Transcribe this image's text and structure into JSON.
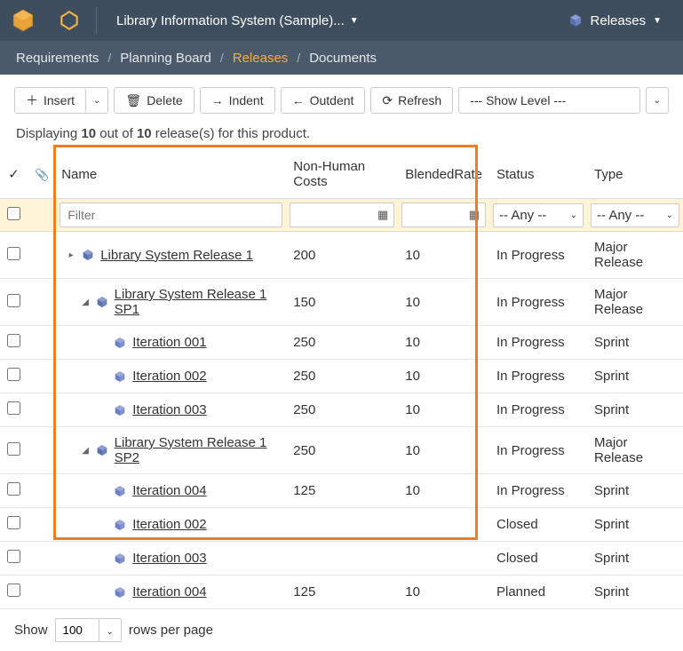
{
  "topbar": {
    "product_label": "Library Information System (Sample)...",
    "releases_label": "Releases"
  },
  "breadcrumb": {
    "items": [
      "Requirements",
      "Planning Board",
      "Releases",
      "Documents"
    ],
    "active_index": 2
  },
  "toolbar": {
    "insert": "Insert",
    "delete": "Delete",
    "indent": "Indent",
    "outdent": "Outdent",
    "refresh": "Refresh",
    "show_level": "--- Show Level ---"
  },
  "summary": {
    "prefix": "Displaying",
    "count": "10",
    "middle": "out of",
    "total": "10",
    "suffix": "release(s) for this product."
  },
  "columns": {
    "name": "Name",
    "cost": "Non-Human Costs",
    "rate": "BlendedRate",
    "status": "Status",
    "type": "Type"
  },
  "filters": {
    "name_placeholder": "Filter",
    "any_label": "-- Any --"
  },
  "rows": [
    {
      "indent": 0,
      "expander": "▸",
      "icon": "release",
      "name": "Library System Release 1",
      "cost": "200",
      "rate": "10",
      "status": "In Progress",
      "type": "Major Release"
    },
    {
      "indent": 1,
      "expander": "◢",
      "icon": "release",
      "name": "Library System Release 1 SP1",
      "cost": "150",
      "rate": "10",
      "status": "In Progress",
      "type": "Major Release"
    },
    {
      "indent": 2,
      "expander": "",
      "icon": "sprint",
      "name": "Iteration 001",
      "cost": "250",
      "rate": "10",
      "status": "In Progress",
      "type": "Sprint"
    },
    {
      "indent": 2,
      "expander": "",
      "icon": "sprint",
      "name": "Iteration 002",
      "cost": "250",
      "rate": "10",
      "status": "In Progress",
      "type": "Sprint"
    },
    {
      "indent": 2,
      "expander": "",
      "icon": "sprint",
      "name": "Iteration 003",
      "cost": "250",
      "rate": "10",
      "status": "In Progress",
      "type": "Sprint"
    },
    {
      "indent": 1,
      "expander": "◢",
      "icon": "release",
      "name": "Library System Release 1 SP2",
      "cost": "250",
      "rate": "10",
      "status": "In Progress",
      "type": "Major Release"
    },
    {
      "indent": 2,
      "expander": "",
      "icon": "sprint",
      "name": "Iteration 004",
      "cost": "125",
      "rate": "10",
      "status": "In Progress",
      "type": "Sprint"
    },
    {
      "indent": 2,
      "expander": "",
      "icon": "sprint",
      "name": "Iteration 002",
      "cost": "",
      "rate": "",
      "status": "Closed",
      "type": "Sprint"
    },
    {
      "indent": 2,
      "expander": "",
      "icon": "sprint",
      "name": "Iteration 003",
      "cost": "",
      "rate": "",
      "status": "Closed",
      "type": "Sprint"
    },
    {
      "indent": 2,
      "expander": "",
      "icon": "sprint",
      "name": "Iteration 004",
      "cost": "125",
      "rate": "10",
      "status": "Planned",
      "type": "Sprint"
    }
  ],
  "footer": {
    "show": "Show",
    "rows": "100",
    "suffix": "rows per page"
  }
}
